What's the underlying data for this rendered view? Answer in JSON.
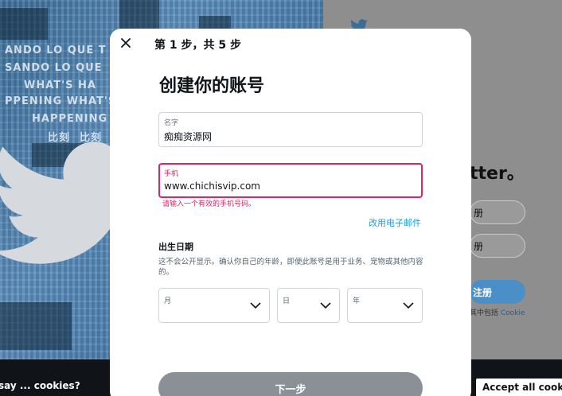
{
  "background": {
    "texts": [
      "ANDO LO QUE T",
      "SANDO LO QUE",
      "WHAT'S HA",
      "PPENING WHAT'S HAP",
      "HAPPENING",
      "比刻",
      "比刻",
      "比刻"
    ],
    "heading": "tter。",
    "button_1": "册",
    "button_2": "册",
    "signup_button": "注册",
    "fine_print": "其中包括",
    "fine_print_link": "Cookie"
  },
  "cookie_bar": {
    "question": "say ... cookies?",
    "accept_label": "Accept all cookies"
  },
  "modal": {
    "step": "第 1 步，共 5 步",
    "title": "创建你的账号",
    "name_field": {
      "label": "名字",
      "value": "痴痴资源网"
    },
    "phone_field": {
      "label": "手机",
      "value": "www.chichisvip.com",
      "error": "请输入一个有效的手机号码。"
    },
    "use_email": "改用电子邮件",
    "dob": {
      "title": "出生日期",
      "note": "这不会公开显示。确认你自己的年龄，即便此账号是用于业务、宠物或其他内容的。",
      "month_label": "月",
      "day_label": "日",
      "year_label": "年"
    },
    "next_button": "下一步"
  },
  "colors": {
    "accent": "#1d9bf0",
    "error": "#e0245e",
    "next_button": "#8a9096"
  },
  "icons": {
    "close": "close-icon",
    "chevron": "chevron-down-icon",
    "bird": "twitter-bird-icon"
  }
}
